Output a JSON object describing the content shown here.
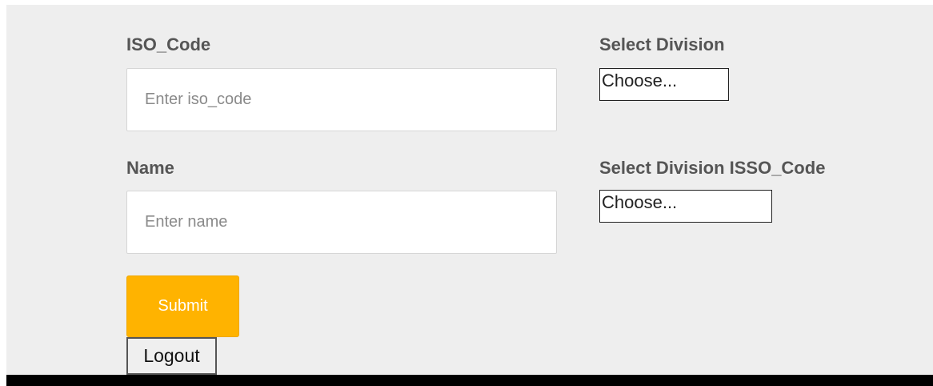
{
  "form": {
    "iso_code": {
      "label": "ISO_Code",
      "placeholder": "Enter iso_code",
      "value": ""
    },
    "name": {
      "label": "Name",
      "placeholder": "Enter name",
      "value": ""
    },
    "division": {
      "label": "Select Division",
      "selected": "Choose..."
    },
    "division_isso_code": {
      "label": "Select Division ISSO_Code",
      "selected": "Choose..."
    },
    "submit_label": "Submit"
  },
  "logout_label": "Logout",
  "colors": {
    "submit_bg": "#ffb300",
    "panel_bg": "#eeeeee",
    "label_text": "#555555"
  }
}
